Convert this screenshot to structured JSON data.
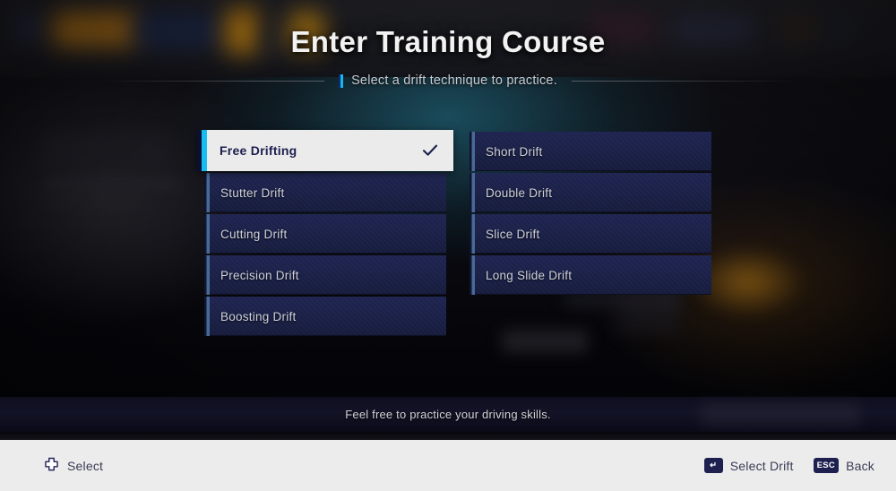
{
  "header": {
    "title": "Enter Training Course",
    "subtitle": "Select a drift technique to practice.",
    "accent_color": "#18b4ef"
  },
  "menu": {
    "selected_index": 0,
    "left_column": [
      {
        "label": "Free Drifting",
        "selected": true,
        "check_icon": "check-icon"
      },
      {
        "label": "Stutter Drift",
        "selected": false
      },
      {
        "label": "Cutting Drift",
        "selected": false
      },
      {
        "label": "Precision Drift",
        "selected": false
      },
      {
        "label": "Boosting Drift",
        "selected": false
      }
    ],
    "right_column": [
      {
        "label": "Short Drift",
        "selected": false
      },
      {
        "label": "Double Drift",
        "selected": false
      },
      {
        "label": "Slice Drift",
        "selected": false
      },
      {
        "label": "Long Slide Drift",
        "selected": false
      }
    ],
    "selected_bg": "#ebebeb",
    "item_bg": "#1b2147",
    "selected_text_color": "#1c1f4e"
  },
  "status": {
    "message": "Feel free to practice your driving skills."
  },
  "footer": {
    "left_hints": [
      {
        "icon": "dpad-icon",
        "label": "Select"
      }
    ],
    "right_hints": [
      {
        "icon": "enter-key-icon",
        "key": "↵",
        "label": "Select Drift"
      },
      {
        "icon": "esc-key-icon",
        "key": "ESC",
        "label": "Back"
      }
    ],
    "background": "#ececec"
  }
}
